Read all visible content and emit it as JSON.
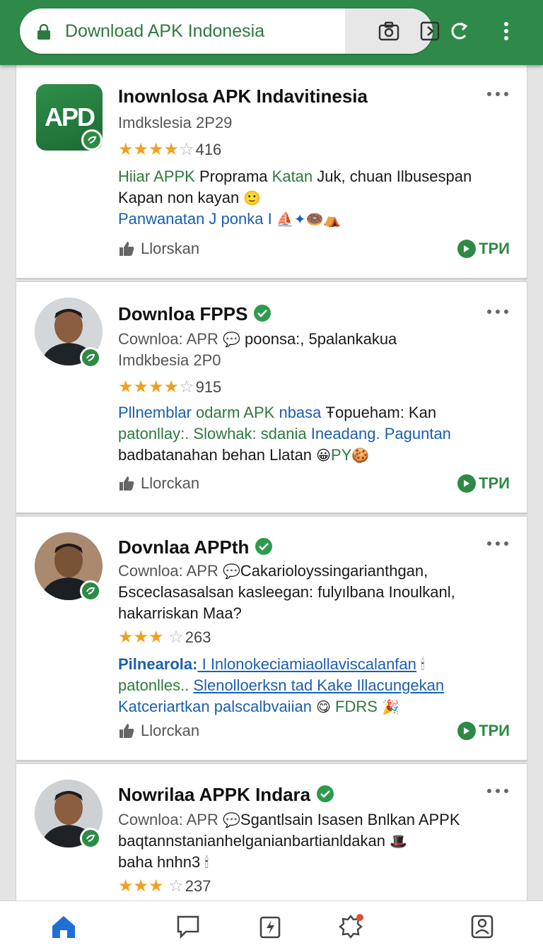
{
  "browser": {
    "url_text": "Download APK Indonesia",
    "icons": [
      "lock-icon",
      "camera-icon",
      "share-icon",
      "refresh-icon",
      "more-vert-icon"
    ],
    "accent_color": "#2f8a4a"
  },
  "posts": [
    {
      "avatar_text": "APD",
      "title": "Inownlosa APK Indavitinesia",
      "subtitle": "Imdkslesia 2P29",
      "stars_filled": 4,
      "stars_total": 5,
      "rating_count": "416",
      "desc_line1_a": "Hiiar APPK",
      "desc_line1_b": " Proprama ",
      "desc_line1_c": "Katan",
      "desc_line1_d": " Juk, chuan Ilbusespan",
      "desc_line2": "Kapan non kayan",
      "desc_line3": "Panwanatan J ponka I",
      "like_label": "Llorskan",
      "action_label": "TPИ"
    },
    {
      "title": "Downloa FPPS",
      "subtitle_a": "Cownloa: APR",
      "subtitle_b": " poonsa:, 5palankakua",
      "subtitle2": "Imdkbesia 2P0",
      "stars_filled": 4,
      "stars_total": 5,
      "rating_count": "915",
      "desc_line1_a": "Pllnemblar",
      "desc_line1_b": " odarm APK ",
      "desc_line1_c": " nbasa ",
      "desc_line1_d": "Ŧopueham: Kan",
      "desc_line2_a": "patonllay:. Slowhak: sdania ",
      "desc_line2_b": "Ineadang. Paguntan",
      "desc_line3_a": "badbatanahan behan Llatan",
      "desc_line3_b": "PY",
      "like_label": "Llorckan",
      "action_label": "TPИ"
    },
    {
      "title": "Dovnlaa APPth",
      "subtitle_a": "Cownloa: APR",
      "subtitle_b": "Cakarioloyssingarianthgan,",
      "subtitle2": "Бsceclasasalsan kasleegan: fulyılbana Inoulkanl,",
      "subtitle3": "hakarriskan Maa?",
      "stars_filled": 3,
      "stars_total": 5,
      "rating_count": "263",
      "desc_line1_a": "Pilnearola:",
      "desc_line1_b": " I Inlonokeciamiaollaviscalanfan",
      "desc_line2_a": "patonlles.. ",
      "desc_line2_b": "Slenolloerksn tad Kake Illacungekan",
      "desc_line3_a": "Katceriartkan palscalbvaiian",
      "desc_line3_b": "FDRS",
      "like_label": "Llorckan",
      "action_label": "TPИ"
    },
    {
      "title": "Nowrilaa APPK Indara",
      "subtitle_a": "Cownloa: APR",
      "subtitle_b": "Sgantlsain Isasen Bnlkan APPK",
      "subtitle2": "baqtannstanianhelganianbartianldakan",
      "subtitle3": "baha hnhn3",
      "stars_filled": 3,
      "stars_total": 5,
      "rating_count": "237"
    }
  ],
  "bottom_nav": [
    "home-icon",
    "chat-icon",
    "download-icon",
    "notifications-icon",
    "profile-icon"
  ],
  "colors": {
    "star": "#f0a020",
    "link_blue": "#1b5fb0",
    "text_green": "#2d7a3e",
    "nav_active": "#1f6fd6"
  }
}
